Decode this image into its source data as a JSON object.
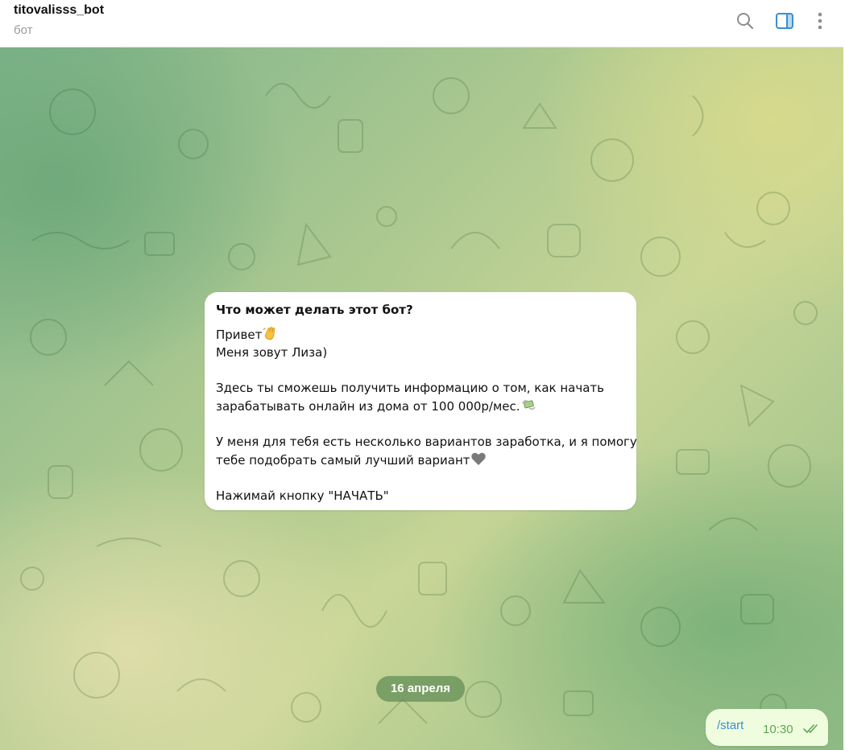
{
  "header": {
    "title": "titovalisss_bot",
    "subtitle": "бот"
  },
  "icons": {
    "search": "search-icon",
    "panel": "sidebar-panel-icon",
    "more": "more-vertical-icon",
    "accent": "#3a8fd0"
  },
  "message": {
    "heading": "Что может делать этот бот?",
    "lines": {
      "l1": "Привет",
      "l2": "Меня зовут Лиза)",
      "l3": "Здесь ты сможешь получить информацию о том, как начать",
      "l4": "зарабатывать онлайн из дома от 100 000р/мес.",
      "l5": "У меня для тебя есть несколько вариантов заработка, и я помогу",
      "l6": "тебе подобрать самый лучший вариант",
      "l7": "Нажимай кнопку \"НАЧАТЬ\""
    },
    "emojis": [
      "waving-hand-icon",
      "money-with-wings-icon",
      "grey-heart-icon"
    ]
  },
  "date_divider": "16 апреля",
  "outgoing": {
    "text": "/start",
    "time": "10:30",
    "status": "read-double-check-icon"
  },
  "colors": {
    "bubble_out": "#effdde",
    "time_green": "#5ea655",
    "date_pill": "#6b9a5c"
  }
}
